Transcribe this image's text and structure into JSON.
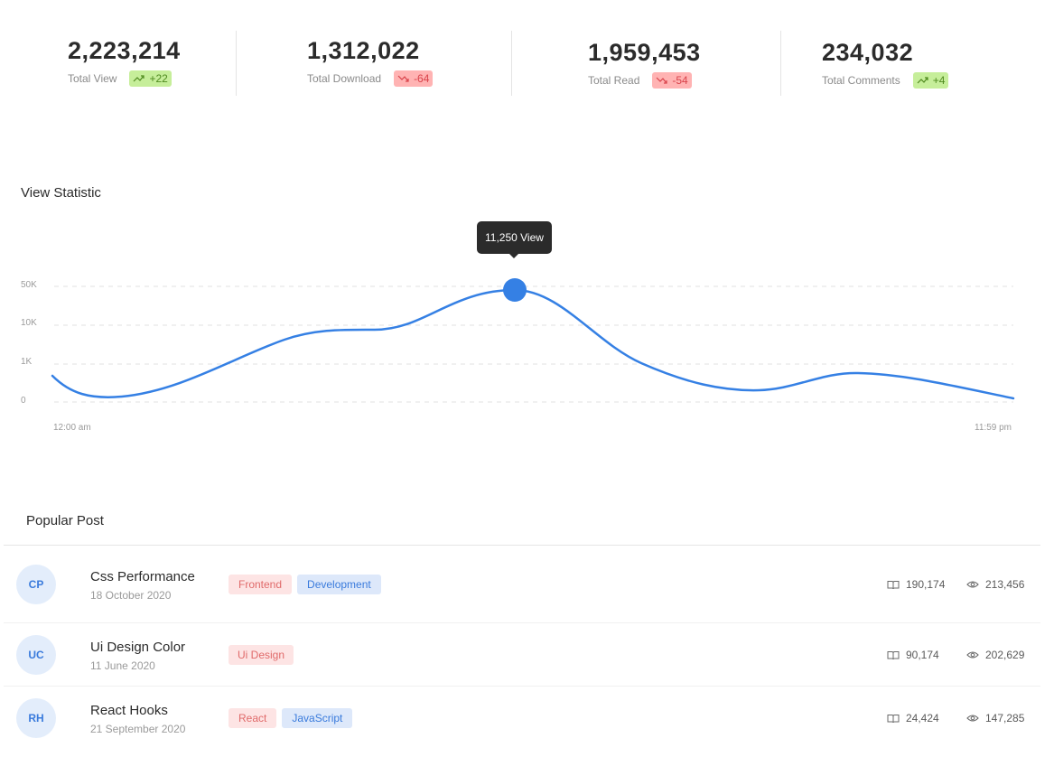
{
  "stats": [
    {
      "value": "2,223,214",
      "label": "Total View",
      "change": "+22",
      "trend": "up"
    },
    {
      "value": "1,312,022",
      "label": "Total Download",
      "change": "-64",
      "trend": "down"
    },
    {
      "value": "1,959,453",
      "label": "Total Read",
      "change": "-54",
      "trend": "down"
    },
    {
      "value": "234,032",
      "label": "Total Comments",
      "change": "+4",
      "trend": "up"
    }
  ],
  "view_statistic": {
    "title": "View Statistic",
    "tooltip": "11,250 View",
    "y_ticks": [
      "50K",
      "10K",
      "1K",
      "0"
    ],
    "x_start": "12:00 am",
    "x_end": "11:59 pm",
    "line_color": "#3580e4"
  },
  "popular_post": {
    "title": "Popular Post",
    "posts": [
      {
        "initials": "CP",
        "title": "Css Performance",
        "date": "18 October 2020",
        "tags": [
          {
            "label": "Frontend",
            "color": "red"
          },
          {
            "label": "Development",
            "color": "blue"
          }
        ],
        "reads": "190,174",
        "views": "213,456"
      },
      {
        "initials": "UC",
        "title": "Ui Design Color",
        "date": "11 June 2020",
        "tags": [
          {
            "label": "Ui Design",
            "color": "red"
          }
        ],
        "reads": "90,174",
        "views": "202,629"
      },
      {
        "initials": "RH",
        "title": "React Hooks",
        "date": "21 September 2020",
        "tags": [
          {
            "label": "React",
            "color": "red"
          },
          {
            "label": "JavaScript",
            "color": "blue"
          }
        ],
        "reads": "24,424",
        "views": "147,285"
      }
    ]
  },
  "icons": {
    "trend_up": "trend-up-icon",
    "trend_down": "trend-down-icon",
    "reads": "book-icon",
    "views": "eye-icon"
  },
  "colors": {
    "up_badge": "#c6ee9a",
    "down_badge": "#ffb3b3",
    "accent": "#3580e4"
  }
}
